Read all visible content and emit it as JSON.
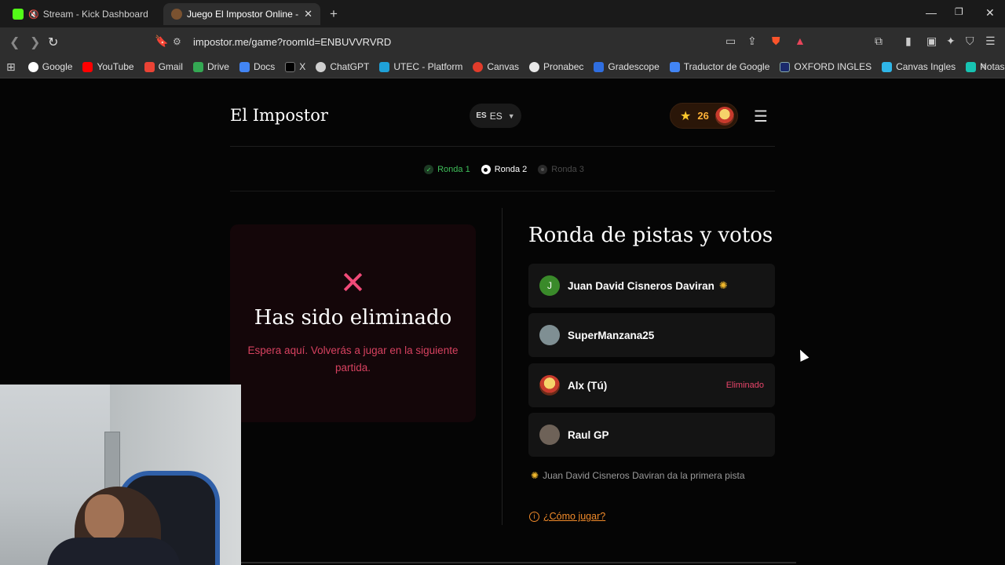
{
  "browser": {
    "tabs": [
      {
        "title": "Stream - Kick Dashboard",
        "favicon_color": "#53fc18",
        "active": false
      },
      {
        "title": "Juego El Impostor Online - Jugar",
        "favicon_color": "#7a5230",
        "active": true
      }
    ],
    "url": "impostor.me/game?roomId=ENBUVVRVRD",
    "bookmarks": [
      {
        "label": "Google",
        "color": "#ffffff"
      },
      {
        "label": "YouTube",
        "color": "#ff0000"
      },
      {
        "label": "Gmail",
        "color": "#ea4335"
      },
      {
        "label": "Drive",
        "color": "#34a853"
      },
      {
        "label": "Docs",
        "color": "#4285f4"
      },
      {
        "label": "X",
        "color": "#000000"
      },
      {
        "label": "ChatGPT",
        "color": "#cfcfcf"
      },
      {
        "label": "UTEC - Platform",
        "color": "#1fa1d8"
      },
      {
        "label": "Canvas",
        "color": "#e13c2b"
      },
      {
        "label": "Pronabec",
        "color": "#2b4aa8"
      },
      {
        "label": "Gradescope",
        "color": "#2f6ee0"
      },
      {
        "label": "Traductor de Google",
        "color": "#4285f4"
      },
      {
        "label": "OXFORD INGLES",
        "color": "#1a2a6c"
      },
      {
        "label": "Canvas Ingles",
        "color": "#2fb6e8"
      },
      {
        "label": "Notas ingles",
        "color": "#17c3b2"
      }
    ]
  },
  "header": {
    "brand": "El Impostor",
    "lang_code": "ES",
    "lang_flag": "ES",
    "score": "26"
  },
  "rounds": [
    {
      "label": "Ronda 1",
      "state": "done"
    },
    {
      "label": "Ronda 2",
      "state": "current"
    },
    {
      "label": "Ronda 3",
      "state": "upcoming"
    }
  ],
  "eliminated": {
    "title": "Has sido eliminado",
    "message": "Espera aquí. Volverás a jugar en la siguiente partida."
  },
  "clues": {
    "title": "Ronda de pistas y votos",
    "players": [
      {
        "name": "Juan David Cisneros Daviran",
        "initial": "J",
        "avatar_color": "#3a8a2a",
        "starter": true,
        "status": ""
      },
      {
        "name": "SuperManzana25",
        "initial": "",
        "avatar_color": "#7f8f93",
        "starter": false,
        "status": ""
      },
      {
        "name": "Alx (Tú)",
        "initial": "",
        "avatar_color": "#d8a23a",
        "starter": false,
        "status": "Eliminado"
      },
      {
        "name": "Raul GP",
        "initial": "",
        "avatar_color": "#6e6258",
        "starter": false,
        "status": ""
      }
    ],
    "hint": "Juan David Cisneros Daviran da la primera pista",
    "how_to": "¿Cómo jugar?"
  }
}
